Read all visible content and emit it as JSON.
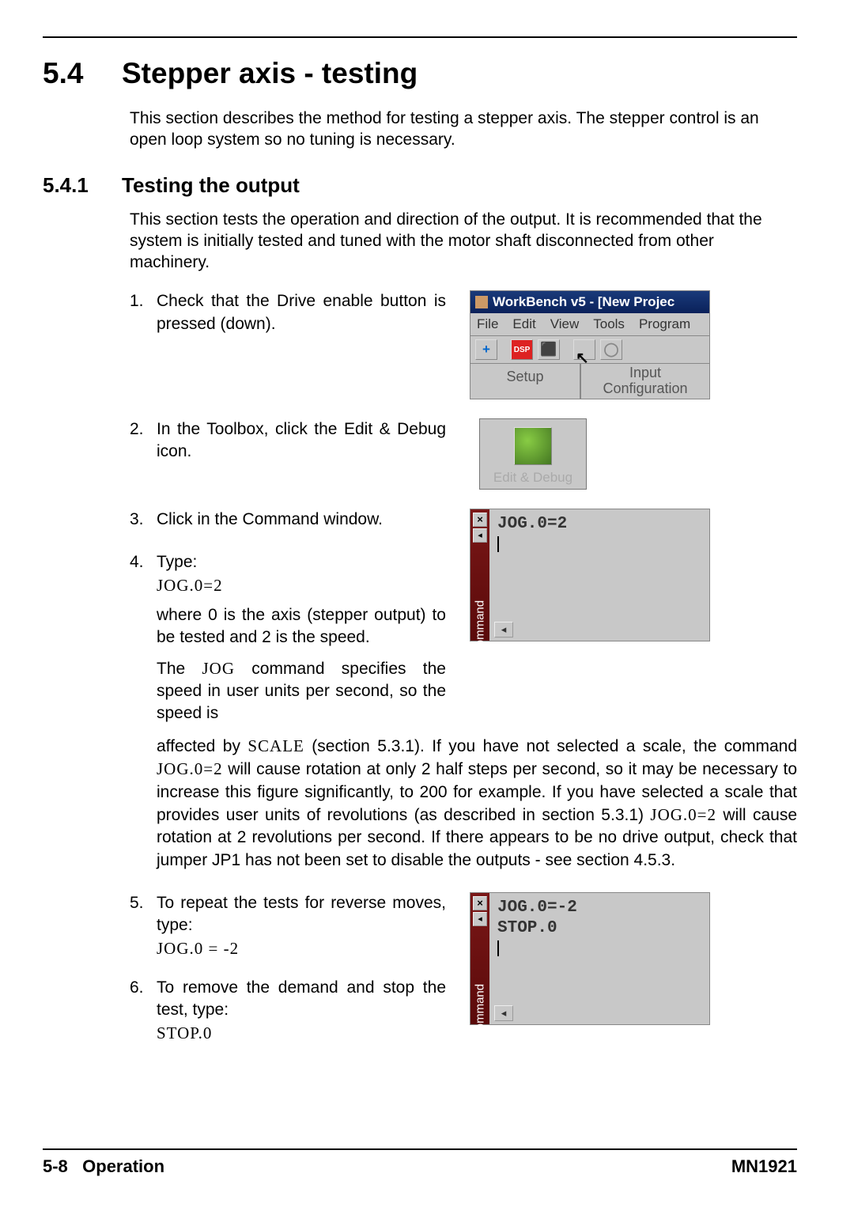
{
  "section": {
    "num": "5.4",
    "title": "Stepper axis - testing"
  },
  "intro": "This section describes the method for testing a stepper axis. The stepper control is an open loop system so no tuning is necessary.",
  "subsection": {
    "num": "5.4.1",
    "title": "Testing the output"
  },
  "subintro": "This section tests the operation and direction of the output. It is recommended that the system is initially tested and tuned with the motor shaft disconnected from other machinery.",
  "steps": {
    "s1": {
      "num": "1.",
      "text": "Check that the Drive enable button is pressed (down)."
    },
    "s2": {
      "num": "2.",
      "text": "In the Toolbox, click the Edit & Debug icon."
    },
    "s3": {
      "num": "3.",
      "text": "Click in the Command window."
    },
    "s4": {
      "num": "4.",
      "text": "Type:",
      "code": "JOG.0=2",
      "p1": "where 0 is the axis (stepper output) to be tested and 2 is the speed.",
      "p2_a": "The ",
      "p2_b": "JOG",
      "p2_c": " command specifies the speed in user units per second, so the speed is",
      "p3_a": "affected by ",
      "p3_b": "SCALE",
      "p3_c": " (section 5.3.1). If you have not selected a scale, the command ",
      "p3_d": "JOG.0=2",
      "p3_e": " will cause rotation at only 2 half steps per second, so it may be necessary to increase this figure significantly, to 200 for example. If you have selected a scale that provides user units of revolutions (as described in section 5.3.1) ",
      "p3_f": "JOG.0=2",
      "p3_g": " will cause rotation at 2 revolutions per second. If there appears to be no drive output, check that jumper JP1 has not been set to disable the outputs - see section 4.5.3."
    },
    "s5": {
      "num": "5.",
      "text": "To repeat the tests for reverse moves, type:",
      "code": "JOG.0 = -2"
    },
    "s6": {
      "num": "6.",
      "text": "To remove the demand and stop the test, type:",
      "code": "STOP.0"
    }
  },
  "workbench": {
    "title": "WorkBench v5 - [New Projec",
    "menu": {
      "file": "File",
      "edit": "Edit",
      "view": "View",
      "tools": "Tools",
      "program": "Program"
    },
    "setup": "Setup",
    "input_line1": "Input",
    "input_line2": "Configuration"
  },
  "edit_debug": {
    "label": "Edit & Debug"
  },
  "command_windows": {
    "side": "Command",
    "w1_line1": "JOG.0=2",
    "w2_line1": "JOG.0=-2",
    "w2_line2": "STOP.0"
  },
  "footer": {
    "left_a": "5-8",
    "left_b": "Operation",
    "right": "MN1921"
  }
}
